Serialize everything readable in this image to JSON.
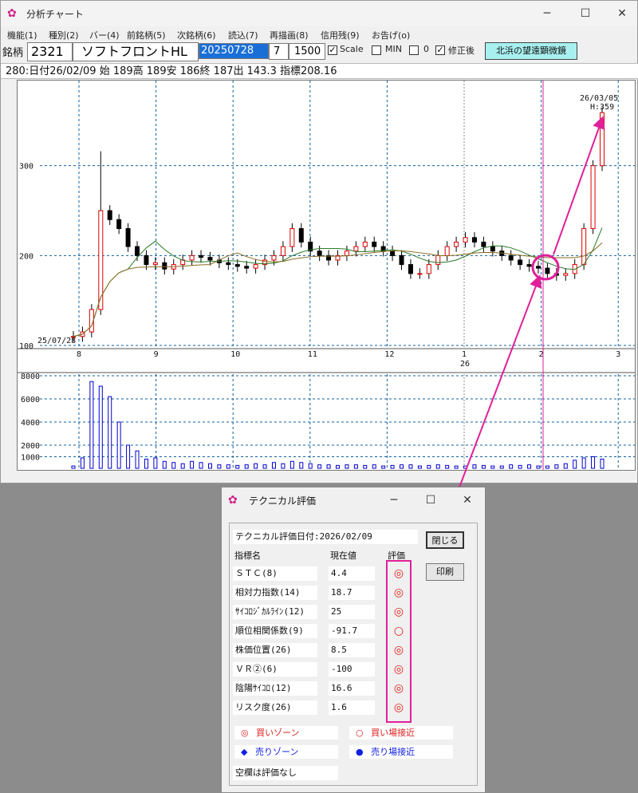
{
  "window": {
    "title": "分析チャート",
    "minimize": "─",
    "maximize": "☐",
    "close": "✕"
  },
  "menu": [
    "機能(1)",
    "種別(2)",
    "バー(4)",
    "前銘柄(5)",
    "次銘柄(6)",
    "読込(7)",
    "再描画(8)",
    "信用残(9)",
    "お告げ(o)"
  ],
  "toolbar": {
    "label": "銘柄",
    "code": "2321",
    "name": "ソフトフロントHL",
    "date": "20250728",
    "num1": "7",
    "num2": "1500",
    "scale_label": "Scale",
    "scale_checked": true,
    "min_label": "MIN",
    "min_checked": false,
    "zero_label": "0",
    "zero_checked": false,
    "adjusted_label": "修正後",
    "adjusted_checked": true,
    "telescope_button": "北浜の望遠顕微鏡"
  },
  "infobar": "280:日付26/02/09 始 189高 189安 186終 187出 143.3 指標208.16",
  "chart_data": {
    "type": "candlestick",
    "start_label": "25/07/28",
    "end_date": "26/03/05",
    "end_high": "H:359",
    "y_ticks": [
      "300",
      "200",
      "100"
    ],
    "ylim": [
      100,
      400
    ],
    "x_ticks": [
      "8",
      "9",
      "10",
      "11",
      "12",
      "1",
      "2",
      "3"
    ],
    "x_year": "26",
    "close_approx": [
      110,
      115,
      140,
      250,
      240,
      230,
      210,
      200,
      190,
      192,
      185,
      190,
      195,
      200,
      198,
      195,
      192,
      190,
      188,
      186,
      190,
      195,
      200,
      210,
      230,
      215,
      205,
      200,
      195,
      200,
      205,
      210,
      215,
      210,
      205,
      200,
      190,
      180,
      180,
      190,
      200,
      210,
      215,
      220,
      215,
      210,
      205,
      200,
      195,
      190,
      188,
      186,
      180,
      178,
      180,
      190,
      230,
      300,
      359
    ],
    "volume_ticks": [
      "8000",
      "6000",
      "4000",
      "2000",
      "1000"
    ],
    "volume_ylim": [
      0,
      8000
    ],
    "volume_approx": [
      200,
      900,
      7500,
      7100,
      6200,
      4000,
      2000,
      1500,
      800,
      900,
      600,
      500,
      400,
      600,
      500,
      400,
      300,
      300,
      250,
      300,
      400,
      300,
      500,
      400,
      600,
      500,
      400,
      300,
      300,
      250,
      300,
      300,
      250,
      300,
      200,
      250,
      300,
      300,
      200,
      250,
      300,
      250,
      200,
      200,
      300,
      250,
      200,
      200,
      300,
      250,
      300,
      200,
      200,
      300,
      400,
      700,
      900,
      1000,
      800
    ]
  },
  "dialog": {
    "title": "テクニカル評価",
    "eval_date": "テクニカル評価日付:2026/02/09",
    "headers": [
      "指標名",
      "現在値",
      "評価"
    ],
    "rows": [
      {
        "name": "ＳＴＣ(8)",
        "value": "4.4",
        "mark": "◎"
      },
      {
        "name": "相対力指数(14)",
        "value": "18.7",
        "mark": "◎"
      },
      {
        "name": "ｻｲｺﾛｼﾞｶﾙﾗｲﾝ(12)",
        "value": "25",
        "mark": "◎"
      },
      {
        "name": "順位相関係数(9)",
        "value": "-91.7",
        "mark": "○"
      },
      {
        "name": "株価位置(26)",
        "value": "8.5",
        "mark": "◎"
      },
      {
        "name": "ＶＲ②(6)",
        "value": "-100",
        "mark": "◎"
      },
      {
        "name": "陰陽ｻｲｺﾛ(12)",
        "value": "16.6",
        "mark": "◎"
      },
      {
        "name": "リスク度(26)",
        "value": "1.6",
        "mark": "◎"
      }
    ],
    "close_button": "閉じる",
    "print_button": "印刷",
    "legend": [
      {
        "symbol": "◎",
        "text": "買いゾーン",
        "color": "#e02020"
      },
      {
        "symbol": "○",
        "text": "買い場接近",
        "color": "#e02020"
      },
      {
        "symbol": "◆",
        "text": "売りゾーン",
        "color": "#1020e0"
      },
      {
        "symbol": "●",
        "text": "売り場接近",
        "color": "#1020e0"
      }
    ],
    "note": "空欄は評価なし"
  },
  "colors": {
    "annotation": "#e0209a",
    "buy": "#e02020",
    "sell": "#1020e0",
    "volume": "#0000d0",
    "grid": "#1060a0"
  }
}
